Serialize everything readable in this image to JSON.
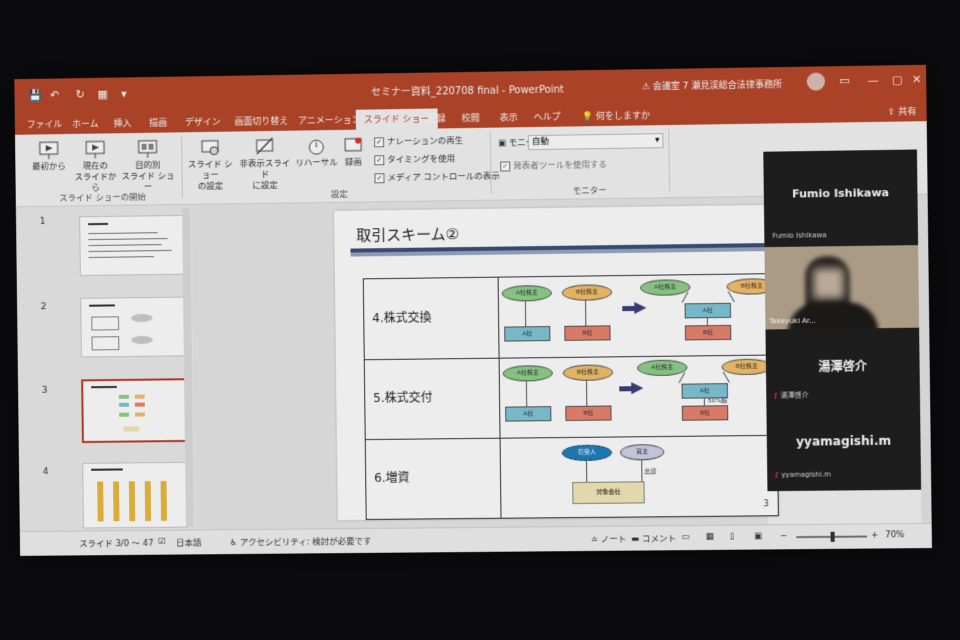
{
  "titlebar": {
    "doc_title": "セミナー資料_220708 final - PowerPoint",
    "warning": "会議室 7  瀬見渓総合法律事務所",
    "save_icon": "save-icon",
    "undo_icon": "undo-icon",
    "redo_icon": "redo-icon",
    "present_icon": "present-icon",
    "customize_icon": "chevron-down-icon"
  },
  "tabs": [
    {
      "label": "ファイル"
    },
    {
      "label": "ホーム"
    },
    {
      "label": "挿入"
    },
    {
      "label": "描画"
    },
    {
      "label": "デザイン"
    },
    {
      "label": "画面切り替え"
    },
    {
      "label": "アニメーション"
    },
    {
      "label": "スライド ショー"
    },
    {
      "label": "記録"
    },
    {
      "label": "校閲"
    },
    {
      "label": "表示"
    },
    {
      "label": "ヘルプ"
    },
    {
      "label": "何をしますか"
    }
  ],
  "share_label": "共有",
  "ribbon": {
    "from_beginning": "最初から",
    "from_current_1": "現在の",
    "from_current_2": "スライドから",
    "custom_1": "目的別",
    "custom_2": "スライド ショー",
    "group_start": "スライド ショーの開始",
    "setup_1": "スライド ショー",
    "setup_2": "の設定",
    "hide_1": "非表示スライド",
    "hide_2": "に設定",
    "rehearse": "リハーサル",
    "record": "録画",
    "group_setup": "設定",
    "chk_narration": "ナレーションの再生",
    "chk_timing": "タイミングを使用",
    "chk_media": "メディア コントロールの表示",
    "monitor_label": "モニター:",
    "monitor_value": "自動",
    "presenter_view": "発表者ツールを使用する",
    "group_monitor": "モニター"
  },
  "thumbnails": [
    {
      "num": "1"
    },
    {
      "num": "2"
    },
    {
      "num": "3"
    },
    {
      "num": "4"
    }
  ],
  "slide": {
    "title": "取引スキーム②",
    "rows": [
      {
        "label": "4.株式交換"
      },
      {
        "label": "5.株式交付"
      },
      {
        "label": "6.増資"
      }
    ],
    "diagram": {
      "a_shareholder": "A社株主",
      "b_shareholder": "B社株主",
      "a_company": "A社",
      "b_company": "B社",
      "subscriber": "引受人",
      "issuer": "買主",
      "target": "対象会社",
      "capital": "出資",
      "pct": "50%超"
    }
  },
  "teams": {
    "name1_big": "Fumio Ishikawa",
    "name1_small": "Fumio Ishikawa",
    "video_name": "Takeyuki Ar...",
    "name2_big": "湯澤啓介",
    "name2_small": "湯澤啓介",
    "name3_big": "yyamagishi.m",
    "name3_small": "yyamagishi.m",
    "page_num": "3"
  },
  "statusbar": {
    "slide_count": "スライド 3/0 〜 47",
    "language": "日本語",
    "accessibility": "アクセシビリティ: 検討が必要です",
    "notes": "ノート",
    "comments": "コメント",
    "zoom": "70%"
  },
  "colors": {
    "accent": "#b7472a",
    "selected_thumb": "#c0392b",
    "title_rule": "#3c4e7a"
  }
}
